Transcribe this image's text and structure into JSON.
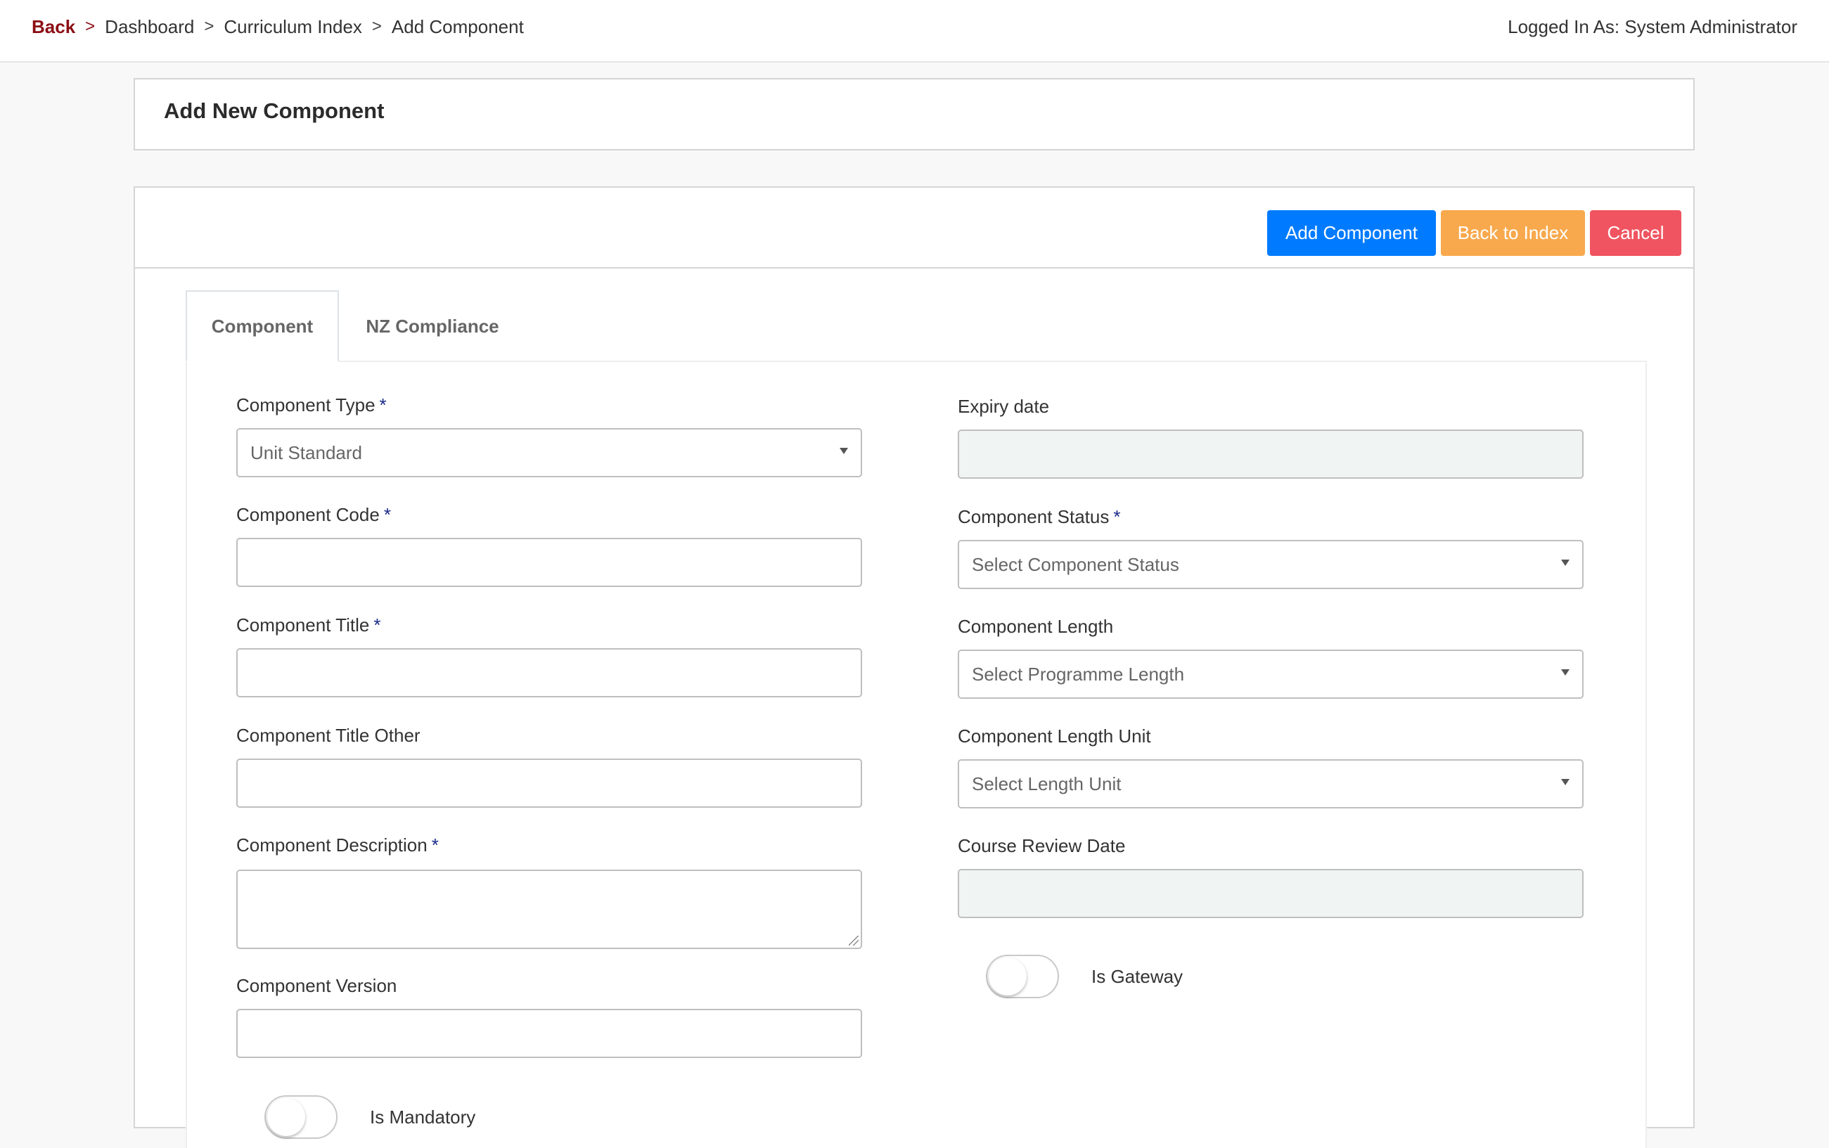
{
  "breadcrumb": {
    "back": "Back",
    "separator": ">",
    "items": [
      "Dashboard",
      "Curriculum Index",
      "Add Component"
    ]
  },
  "user": {
    "logged_in_text": "Logged In As: System Administrator"
  },
  "page": {
    "title": "Add New Component"
  },
  "actions": {
    "add_component": "Add Component",
    "back_to_index": "Back to Index",
    "cancel": "Cancel"
  },
  "tabs": [
    {
      "label": "Component",
      "active": true
    },
    {
      "label": "NZ Compliance",
      "active": false
    }
  ],
  "form": {
    "required_mark": "*",
    "left": {
      "component_type": {
        "label": "Component Type",
        "value": "Unit Standard"
      },
      "component_code": {
        "label": "Component Code",
        "value": ""
      },
      "component_title": {
        "label": "Component Title",
        "value": ""
      },
      "component_title_other": {
        "label": "Component Title Other",
        "value": ""
      },
      "component_description": {
        "label": "Component Description",
        "value": ""
      },
      "component_version": {
        "label": "Component Version",
        "value": ""
      },
      "is_mandatory": {
        "label": "Is Mandatory",
        "checked": false
      }
    },
    "right": {
      "expiry_date": {
        "label": "Expiry date",
        "value": ""
      },
      "component_status": {
        "label": "Component Status",
        "placeholder": "Select Component Status"
      },
      "component_length": {
        "label": "Component Length",
        "placeholder": "Select Programme Length"
      },
      "component_length_unit": {
        "label": "Component Length Unit",
        "placeholder": "Select Length Unit"
      },
      "course_review_date": {
        "label": "Course Review Date",
        "value": ""
      },
      "is_gateway": {
        "label": "Is Gateway",
        "checked": false
      }
    }
  },
  "colors": {
    "primary": "#007bff",
    "warning": "#f8a94d",
    "danger": "#f05460",
    "back_link": "#8b0d14",
    "required": "#1a2a8a"
  }
}
